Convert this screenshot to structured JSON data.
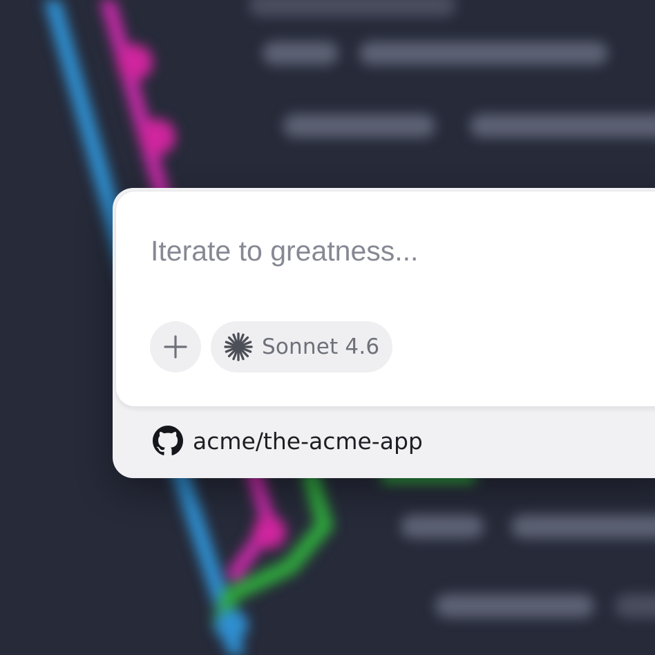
{
  "composer": {
    "placeholder": "Iterate to greatness...",
    "add_button": {
      "icon": "plus-icon"
    },
    "model_selector": {
      "icon": "sparkle-icon",
      "label": "Sonnet 4.6"
    }
  },
  "repository": {
    "icon": "github-icon",
    "name": "acme/the-acme-app"
  },
  "colors": {
    "background": "#262a39",
    "graph_blue": "#2f8fd0",
    "graph_magenta": "#c42aa6",
    "graph_green": "#2fa63d",
    "card": "#ffffff",
    "card_footer": "#f1f1f3",
    "chip": "#efeff1"
  }
}
